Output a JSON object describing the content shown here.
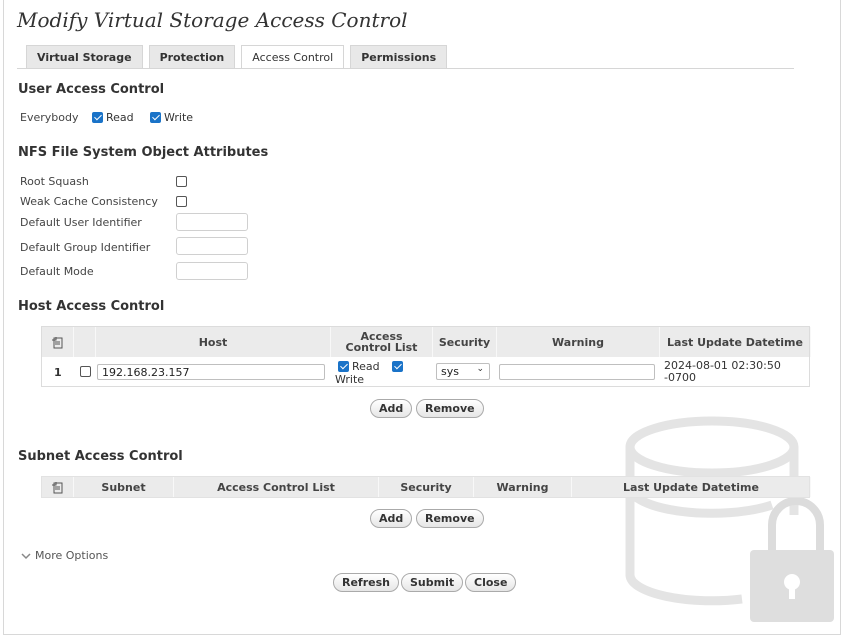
{
  "page": {
    "title": "Modify Virtual Storage Access Control"
  },
  "tabs": [
    {
      "label": "Virtual Storage",
      "active": false
    },
    {
      "label": "Protection",
      "active": false
    },
    {
      "label": "Access Control",
      "active": true
    },
    {
      "label": "Permissions",
      "active": false
    }
  ],
  "user_access": {
    "title": "User Access Control",
    "everybody_label": "Everybody",
    "read_label": "Read",
    "read_checked": true,
    "write_label": "Write",
    "write_checked": true
  },
  "nfs": {
    "title": "NFS File System Object Attributes",
    "root_squash_label": "Root Squash",
    "root_squash_checked": false,
    "weak_cache_label": "Weak Cache Consistency",
    "weak_cache_checked": false,
    "default_user_label": "Default User Identifier",
    "default_user_value": "",
    "default_group_label": "Default Group Identifier",
    "default_group_value": "",
    "default_mode_label": "Default Mode",
    "default_mode_value": ""
  },
  "host_access": {
    "title": "Host Access Control",
    "columns": {
      "host": "Host",
      "acl": "Access Control List",
      "security": "Security",
      "warning": "Warning",
      "last_update": "Last Update Datetime"
    },
    "rows": [
      {
        "num": "1",
        "selected": false,
        "host": "192.168.23.157",
        "read_label": "Read",
        "read_checked": true,
        "write_label": "Write",
        "write_checked": true,
        "security": "sys",
        "warning": "",
        "last_update": "2024-08-01 02:30:50 -0700"
      }
    ],
    "add_label": "Add",
    "remove_label": "Remove"
  },
  "subnet_access": {
    "title": "Subnet Access Control",
    "columns": {
      "subnet": "Subnet",
      "acl": "Access Control List",
      "security": "Security",
      "warning": "Warning",
      "last_update": "Last Update Datetime"
    },
    "add_label": "Add",
    "remove_label": "Remove"
  },
  "more_options_label": "More Options",
  "footer": {
    "refresh_label": "Refresh",
    "submit_label": "Submit",
    "close_label": "Close"
  },
  "icons": {
    "column_chooser": "column-chooser-icon",
    "expand": "chevron-down-icon",
    "watermark": "storage-lock-icon"
  },
  "colors": {
    "checkbox_accent": "#1a73c8",
    "header_bg": "#ebebeb"
  }
}
